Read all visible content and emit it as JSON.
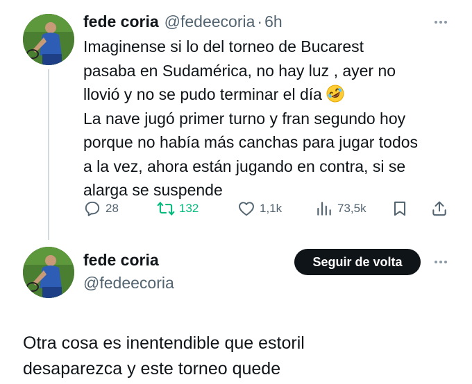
{
  "tweet1": {
    "display_name": "fede coria",
    "handle": "@fedeecoria",
    "separator": "·",
    "time": "6h",
    "lines": [
      "Imaginense si lo del torneo de Bucarest",
      "pasaba en Sudamérica, no hay luz , ayer no",
      "llovió y no se pudo terminar el día",
      "La nave jugó primer turno y fran segundo hoy",
      "porque no había más canchas para jugar todos",
      "a la vez, ahora están jugando en contra, si se",
      "alarga se suspende"
    ],
    "emoji": "rolling-on-floor-laughing-emoji",
    "stats": {
      "replies": "28",
      "retweets": "132",
      "likes": "1,1k",
      "views": "73,5k"
    }
  },
  "tweet2": {
    "display_name": "fede coria",
    "handle": "@fedeecoria",
    "follow_label": "Seguir de volta",
    "lines": [
      "Otra cosa es inentendible que estoril",
      "desaparezca y este torneo quede"
    ]
  },
  "icons": {
    "more": "more-dots-icon",
    "reply": "reply-icon",
    "retweet": "retweet-icon",
    "like": "heart-icon",
    "views": "views-chart-icon",
    "bookmark": "bookmark-icon",
    "share": "share-icon"
  },
  "colors": {
    "text": "#0f1419",
    "secondary": "#536471",
    "retweet_active": "#00ba7c",
    "thread_line": "#cfd9de",
    "follow_button_bg": "#0f1419"
  }
}
